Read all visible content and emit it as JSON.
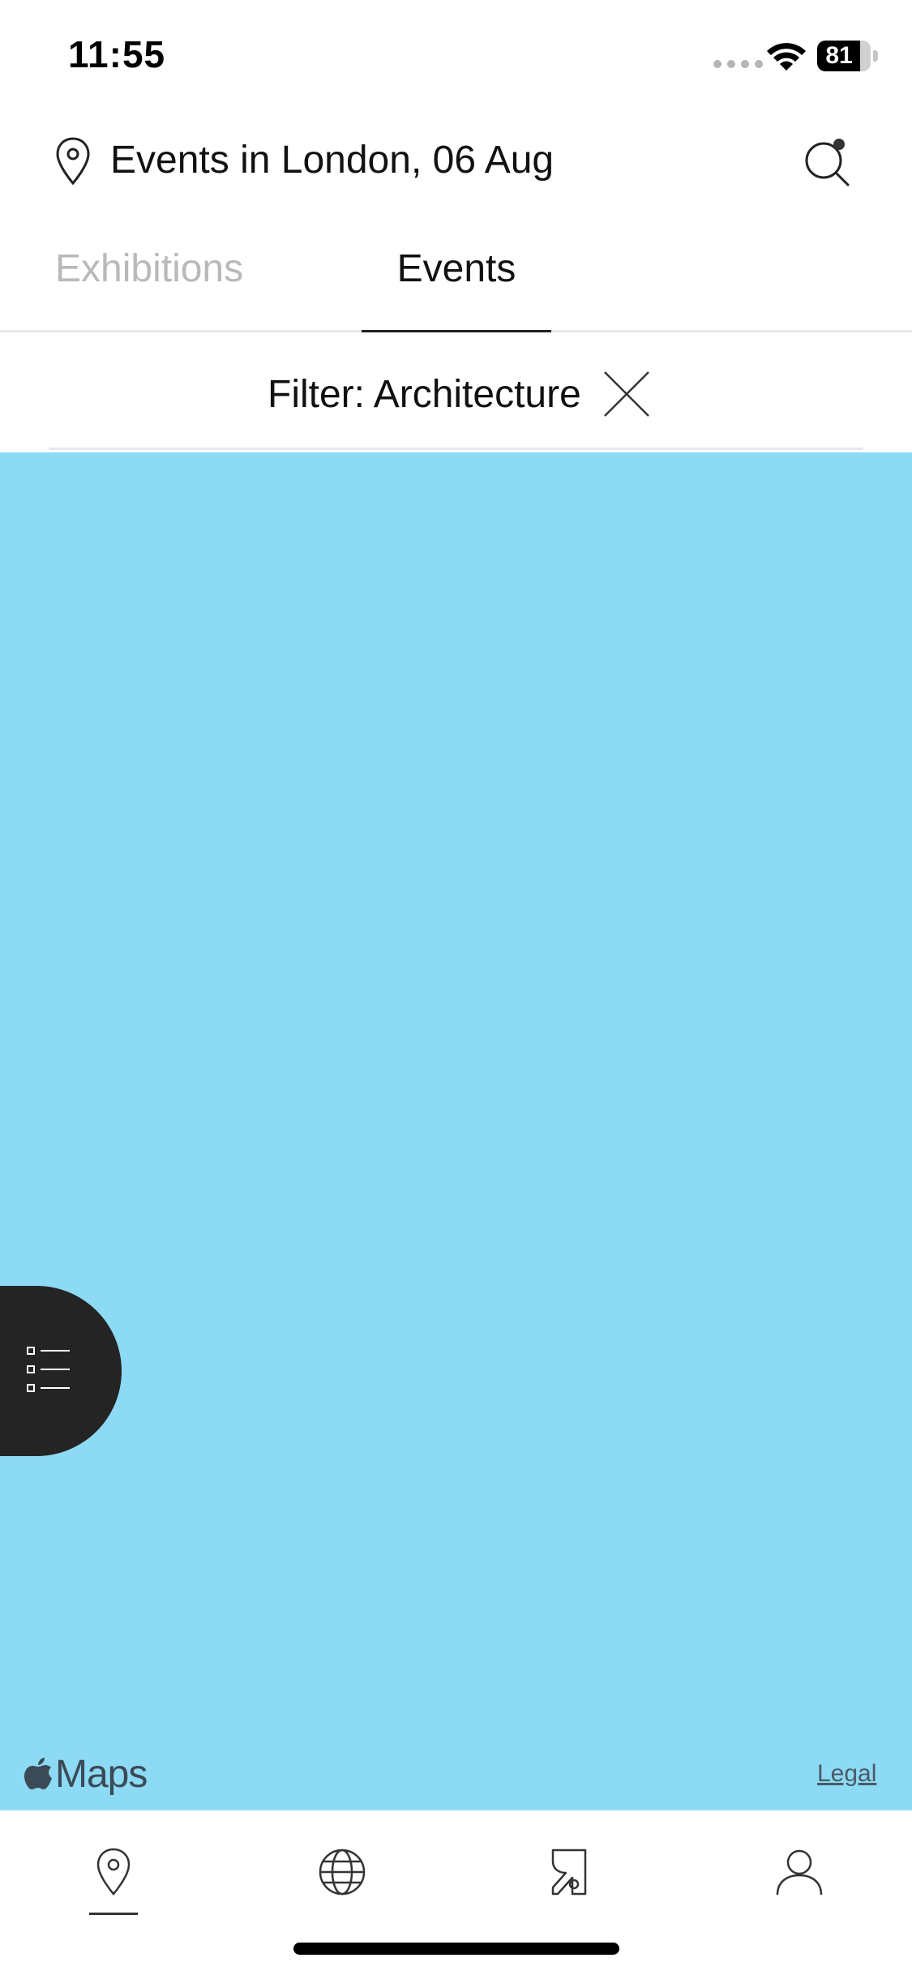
{
  "status_bar": {
    "time": "11:55",
    "battery_level": 81,
    "battery_label": "81"
  },
  "header": {
    "title": "Events in London, 06 Aug",
    "location_icon": "location-pin-icon",
    "search_icon": "search-icon"
  },
  "tabs": [
    {
      "label": "Exhibitions",
      "active": false
    },
    {
      "label": "Events",
      "active": true
    }
  ],
  "filter": {
    "label": "Filter: Architecture",
    "clear_icon": "close-icon"
  },
  "map": {
    "background_color": "#8ddaf4",
    "list_toggle_icon": "list-icon",
    "attribution": "Maps",
    "legal_label": "Legal"
  },
  "tab_bar": {
    "items": [
      {
        "icon": "map-pin-icon",
        "active": true
      },
      {
        "icon": "globe-icon",
        "active": false
      },
      {
        "icon": "r-logo-icon",
        "active": false
      },
      {
        "icon": "profile-icon",
        "active": false
      }
    ]
  },
  "colors": {
    "accent_dark": "#242424",
    "tab_inactive": "#b9b9b9",
    "map_water": "#8ddaf4"
  }
}
